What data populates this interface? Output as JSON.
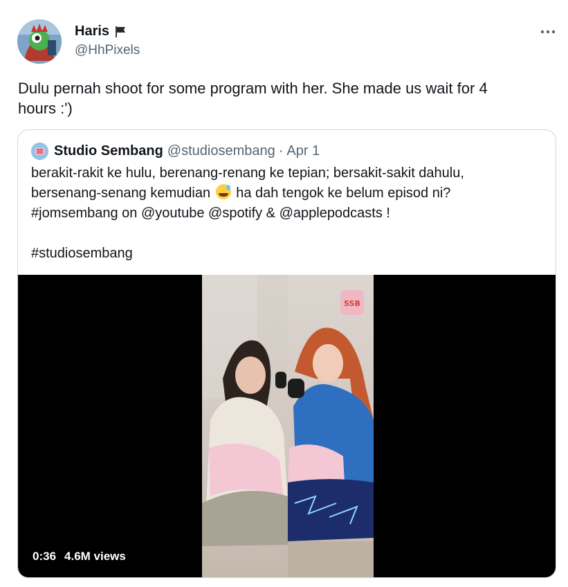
{
  "author": {
    "name": "Haris",
    "handle": "@HhPixels",
    "flag_icon": "black-flag-icon"
  },
  "tweet": {
    "text_lines": [
      "Dulu pernah shoot for some program with her. She made us wait for 4",
      "hours :')"
    ]
  },
  "quote": {
    "name": "Studio Sembang",
    "handle": "@studiosembang",
    "separator": "·",
    "date": "Apr 1",
    "lines": [
      "berakit-rakit ke hulu, berenang-renang ke tepian; bersakit-sakit dahulu,",
      "bersenang-senang kemudian",
      "ha dah tengok ke belum episod ni?",
      "#jomsembang on @youtube @spotify & @applepodcasts !",
      "#studiosembang"
    ],
    "emoji": "sweat-smile-emoji",
    "media": {
      "duration": "0:36",
      "views": "4.6M views"
    }
  },
  "colors": {
    "text": "#0f1419",
    "secondary": "#536471",
    "border": "#cfd9de",
    "media_bg": "#000000"
  }
}
